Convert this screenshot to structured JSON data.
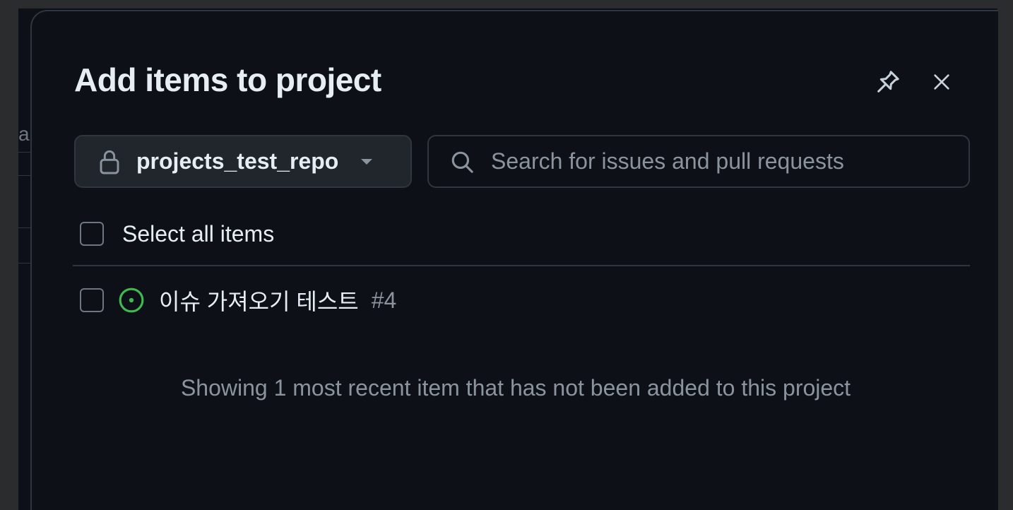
{
  "dialog": {
    "title": "Add items to project",
    "pin_icon": "pin-icon",
    "close_icon": "x-icon"
  },
  "background": {
    "partial_text": "a"
  },
  "repo_selector": {
    "icon": "lock-icon",
    "value": "projects_test_repo",
    "caret_icon": "triangle-down-icon"
  },
  "search": {
    "icon": "search-icon",
    "placeholder": "Search for issues and pull requests",
    "value": ""
  },
  "select_all": {
    "label": "Select all items",
    "checked": false
  },
  "items": [
    {
      "title": "이슈 가져오기 테스트",
      "number": "#4",
      "status_icon": "issue-opened-icon",
      "status_color": "#3fb950",
      "checked": false
    }
  ],
  "footer": {
    "note": "Showing 1 most recent item that has not been added to this project"
  },
  "colors": {
    "background": "#0d1117",
    "border": "#30363d",
    "text_primary": "#e6edf3",
    "text_muted": "#8b949e",
    "open_green": "#3fb950"
  }
}
